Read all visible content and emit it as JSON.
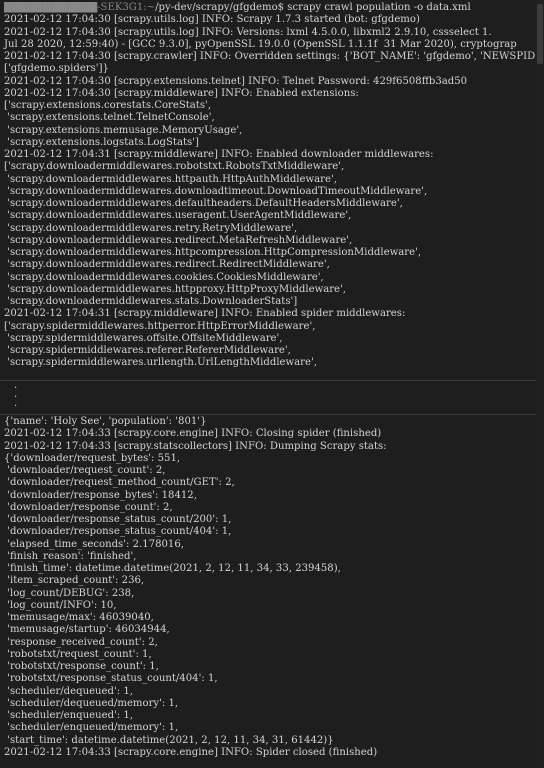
{
  "terminal": {
    "prompt_host": "████████████-SEK3G1:~",
    "prompt_path": "/py-dev/scrapy/gfgdemo$ scrapy crawl population -o data.xml",
    "top_lines": [
      "2021-02-12 17:04:30 [scrapy.utils.log] INFO: Scrapy 1.7.3 started (bot: gfgdemo)",
      "2021-02-12 17:04:30 [scrapy.utils.log] INFO: Versions: lxml 4.5.0.0, libxml2 2.9.10, cssselect 1.",
      "Jul 28 2020, 12:59:40) - [GCC 9.3.0], pyOpenSSL 19.0.0 (OpenSSL 1.1.1f  31 Mar 2020), cryptograp",
      "2021-02-12 17:04:30 [scrapy.crawler] INFO: Overridden settings: {'BOT_NAME': 'gfgdemo', 'NEWSPID",
      "['gfgdemo.spiders']}",
      "2021-02-12 17:04:30 [scrapy.extensions.telnet] INFO: Telnet Password: 429f6508ffb3ad50",
      "2021-02-12 17:04:30 [scrapy.middleware] INFO: Enabled extensions:",
      "['scrapy.extensions.corestats.CoreStats',",
      " 'scrapy.extensions.telnet.TelnetConsole',",
      " 'scrapy.extensions.memusage.MemoryUsage',",
      " 'scrapy.extensions.logstats.LogStats']",
      "2021-02-12 17:04:31 [scrapy.middleware] INFO: Enabled downloader middlewares:",
      "['scrapy.downloadermiddlewares.robotstxt.RobotsTxtMiddleware',",
      " 'scrapy.downloadermiddlewares.httpauth.HttpAuthMiddleware',",
      " 'scrapy.downloadermiddlewares.downloadtimeout.DownloadTimeoutMiddleware',",
      " 'scrapy.downloadermiddlewares.defaultheaders.DefaultHeadersMiddleware',",
      " 'scrapy.downloadermiddlewares.useragent.UserAgentMiddleware',",
      " 'scrapy.downloadermiddlewares.retry.RetryMiddleware',",
      " 'scrapy.downloadermiddlewares.redirect.MetaRefreshMiddleware',",
      " 'scrapy.downloadermiddlewares.httpcompression.HttpCompressionMiddleware',",
      " 'scrapy.downloadermiddlewares.redirect.RedirectMiddleware',",
      " 'scrapy.downloadermiddlewares.cookies.CookiesMiddleware',",
      " 'scrapy.downloadermiddlewares.httpproxy.HttpProxyMiddleware',",
      " 'scrapy.downloadermiddlewares.stats.DownloaderStats']",
      "2021-02-12 17:04:31 [scrapy.middleware] INFO: Enabled spider middlewares:",
      "['scrapy.spidermiddlewares.httperror.HttpErrorMiddleware',",
      " 'scrapy.spidermiddlewares.offsite.OffsiteMiddleware',",
      " 'scrapy.spidermiddlewares.referer.RefererMiddleware',",
      " 'scrapy.spidermiddlewares.urllength.UrlLengthMiddleware',"
    ],
    "ellipsis": ".\n.\n.",
    "bottom_lines": [
      "{'name': 'Holy See', 'population': '801'}",
      "2021-02-12 17:04:33 [scrapy.core.engine] INFO: Closing spider (finished)",
      "2021-02-12 17:04:33 [scrapy.statscollectors] INFO: Dumping Scrapy stats:",
      "{'downloader/request_bytes': 551,",
      " 'downloader/request_count': 2,",
      " 'downloader/request_method_count/GET': 2,",
      " 'downloader/response_bytes': 18412,",
      " 'downloader/response_count': 2,",
      " 'downloader/response_status_count/200': 1,",
      " 'downloader/response_status_count/404': 1,",
      " 'elapsed_time_seconds': 2.178016,",
      " 'finish_reason': 'finished',",
      " 'finish_time': datetime.datetime(2021, 2, 12, 11, 34, 33, 239458),",
      " 'item_scraped_count': 236,",
      " 'log_count/DEBUG': 238,",
      " 'log_count/INFO': 10,",
      " 'memusage/max': 46039040,",
      " 'memusage/startup': 46034944,",
      " 'response_received_count': 2,",
      " 'robotstxt/request_count': 1,",
      " 'robotstxt/response_count': 1,",
      " 'robotstxt/response_status_count/404': 1,",
      " 'scheduler/dequeued': 1,",
      " 'scheduler/dequeued/memory': 1,",
      " 'scheduler/enqueued': 1,",
      " 'scheduler/enqueued/memory': 1,",
      " 'start_time': datetime.datetime(2021, 2, 12, 11, 34, 31, 61442)}",
      "2021-02-12 17:04:33 [scrapy.core.engine] INFO: Spider closed (finished)"
    ]
  },
  "colors": {
    "background": "#1e1e1e",
    "text": "#d4d4d4"
  }
}
